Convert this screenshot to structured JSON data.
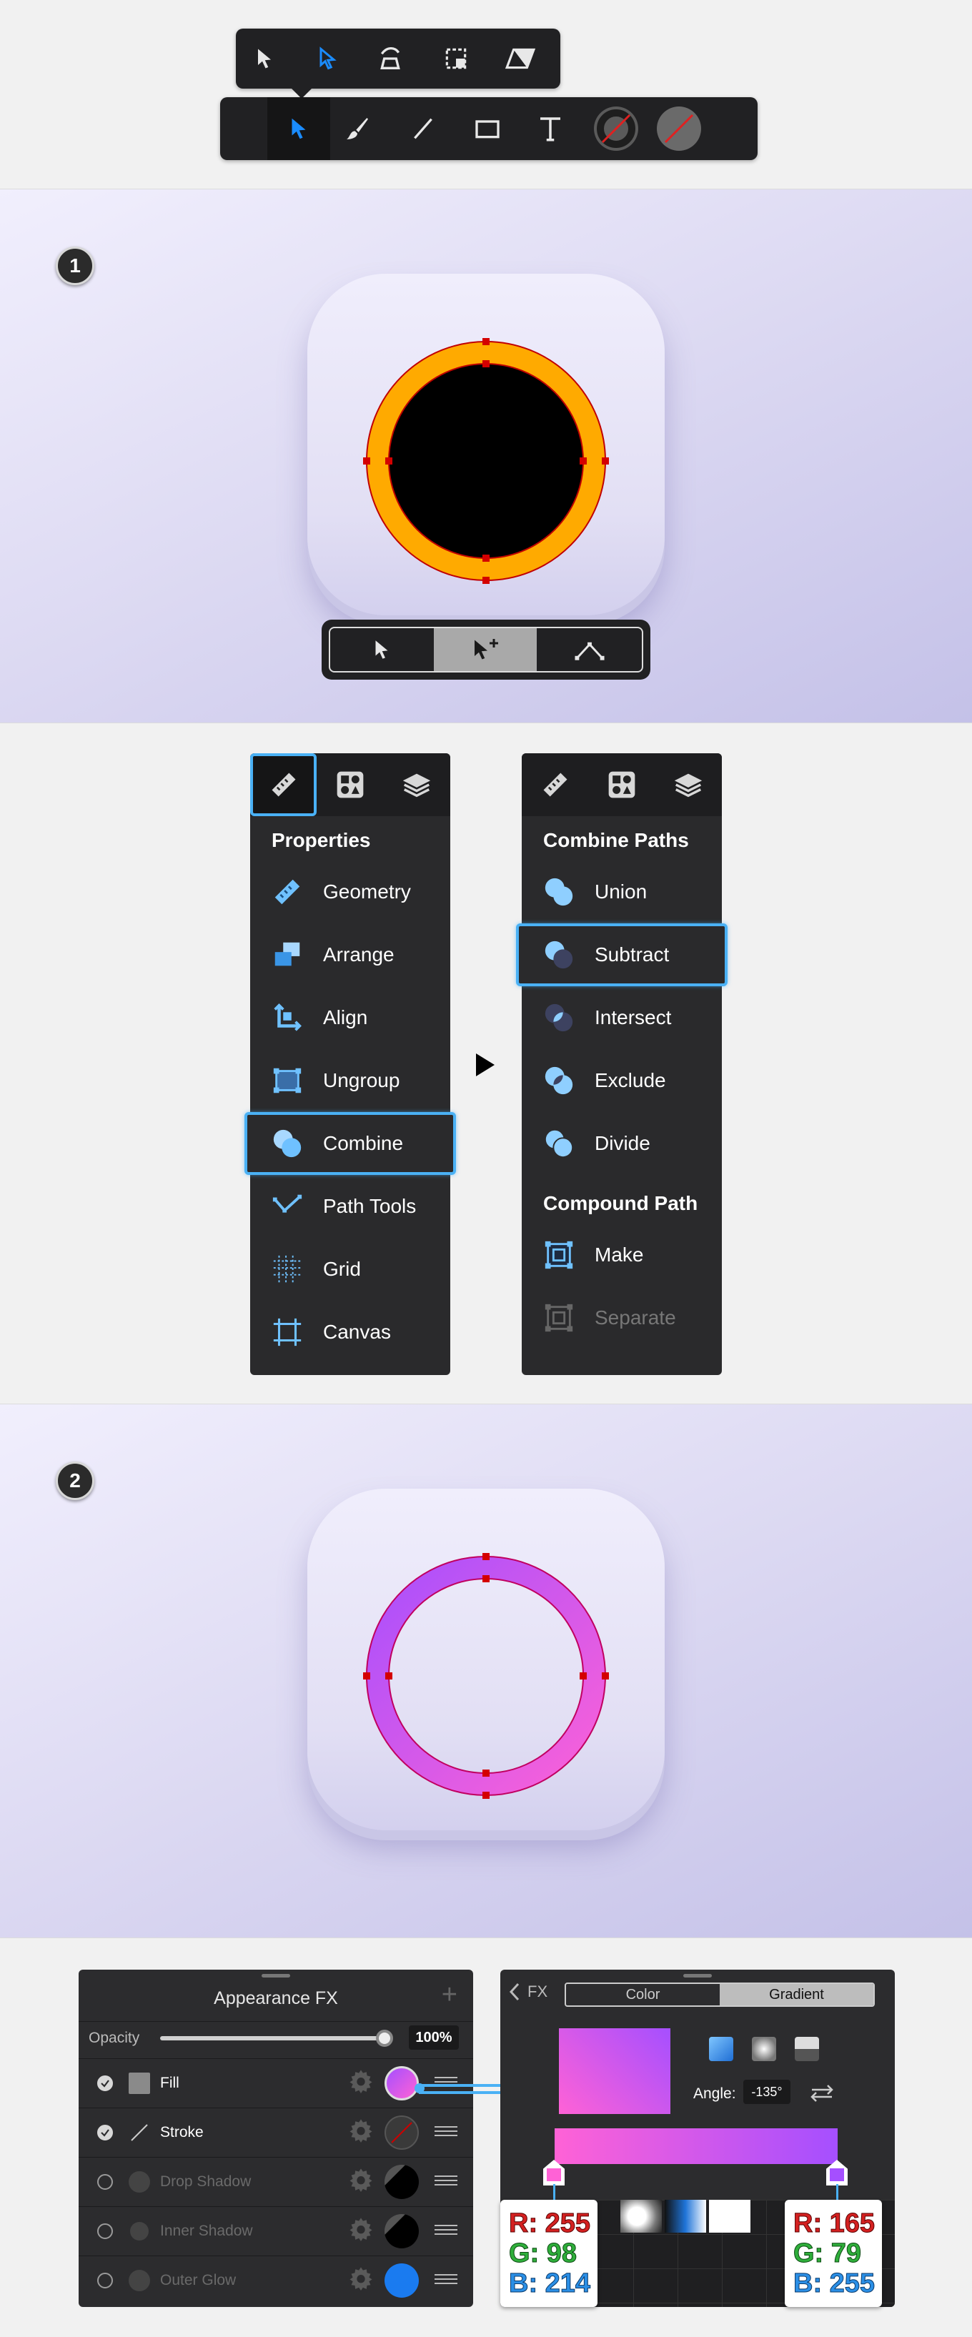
{
  "toolbar": {
    "sub_tools": [
      "move-tool",
      "direct-select-tool",
      "transform-tool",
      "crop-tool",
      "skew-tool"
    ],
    "main_tools": [
      "node-tool",
      "brush-tool",
      "line-tool",
      "rectangle-tool",
      "text-tool",
      "fill-swatch",
      "stroke-swatch"
    ],
    "accent": "#1a8cff"
  },
  "step1": {
    "badge": "1",
    "ring_color": "#ffaa00",
    "ring_stroke": "#d40000",
    "context_toolbar": [
      "select-icon",
      "select-add-icon",
      "node-icon"
    ]
  },
  "properties_panel": {
    "heading": "Properties",
    "items": [
      "Geometry",
      "Arrange",
      "Align",
      "Ungroup",
      "Combine",
      "Path Tools",
      "Grid",
      "Canvas"
    ]
  },
  "combine_panel": {
    "heading": "Combine Paths",
    "items": [
      "Union",
      "Subtract",
      "Intersect",
      "Exclude",
      "Divide"
    ],
    "compound_heading": "Compound Path",
    "compound_items": [
      "Make",
      "Separate"
    ]
  },
  "step2": {
    "badge": "2",
    "gradient_start": "#a54fff",
    "gradient_end": "#ff62d6"
  },
  "appearance": {
    "title": "Appearance FX",
    "add": "+",
    "opacity_label": "Opacity",
    "opacity_value": "100%",
    "opacity_fraction": 1.0,
    "rows": [
      {
        "label": "Fill",
        "enabled": true
      },
      {
        "label": "Stroke",
        "enabled": true
      },
      {
        "label": "Drop Shadow",
        "enabled": false
      },
      {
        "label": "Inner Shadow",
        "enabled": false
      },
      {
        "label": "Outer Glow",
        "enabled": false
      }
    ]
  },
  "fx": {
    "back": "FX",
    "tab_color": "Color",
    "tab_gradient": "Gradient",
    "angle_label": "Angle:",
    "angle_value": "-135°"
  },
  "rgb_left": {
    "r": "R: 255",
    "g": "G: 98",
    "b": "B: 214"
  },
  "rgb_right": {
    "r": "R: 165",
    "g": "G: 79",
    "b": "B: 255"
  }
}
